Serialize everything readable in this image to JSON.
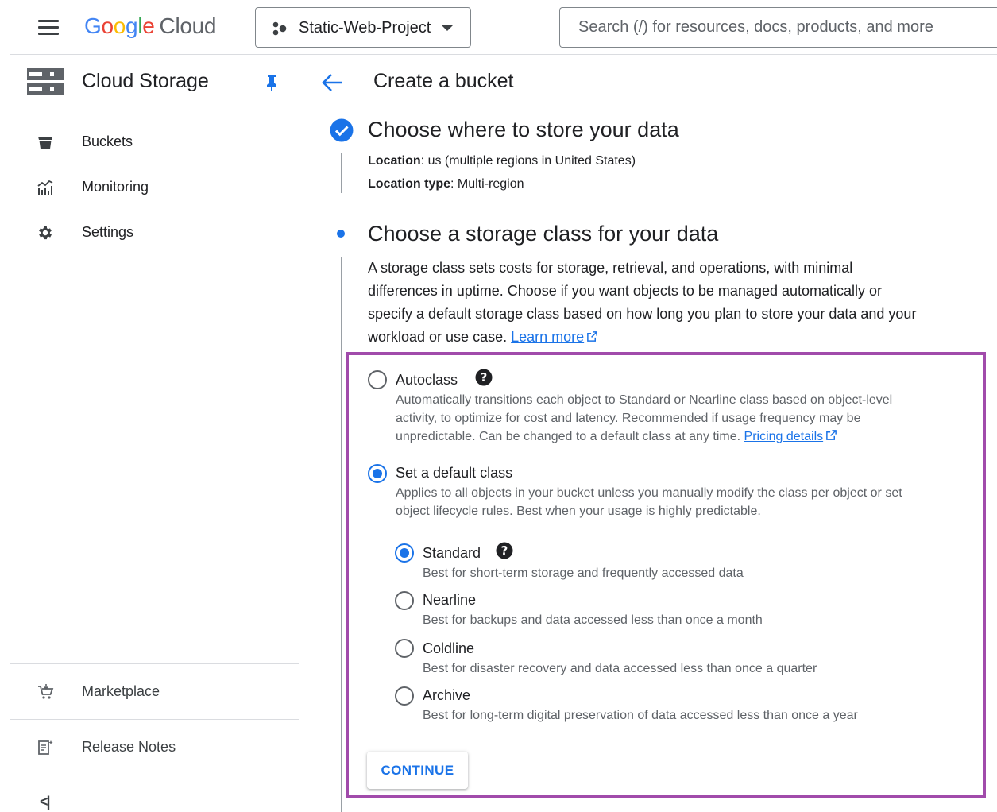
{
  "topbar": {
    "logo_google": [
      "G",
      "o",
      "o",
      "g",
      "l",
      "e"
    ],
    "logo_cloud": "Cloud",
    "project_name": "Static-Web-Project",
    "search_placeholder": "Search (/) for resources, docs, products, and more"
  },
  "sidebar": {
    "title": "Cloud Storage",
    "items": [
      {
        "label": "Buckets",
        "icon": "bucket-icon"
      },
      {
        "label": "Monitoring",
        "icon": "monitoring-icon"
      },
      {
        "label": "Settings",
        "icon": "gear-icon"
      }
    ],
    "bottom_items": [
      {
        "label": "Marketplace",
        "icon": "cart-icon"
      },
      {
        "label": "Release Notes",
        "icon": "notes-icon"
      }
    ],
    "collapse_label": "<|"
  },
  "header": {
    "title": "Create a bucket"
  },
  "step1": {
    "title": "Choose where to store your data",
    "location_key": "Location",
    "location_value": ": us (multiple regions in United States)",
    "location_type_key": "Location type",
    "location_type_value": ": Multi-region"
  },
  "step2": {
    "title": "Choose a storage class for your data",
    "description": "A storage class sets costs for storage, retrieval, and operations, with minimal differences in uptime. Choose if you want objects to be managed automatically or specify a default storage class based on how long you plan to store your data and your workload or use case.",
    "learn_more": "Learn more",
    "autoclass": {
      "label": "Autoclass",
      "description": "Automatically transitions each object to Standard or Nearline class based on object-level activity, to optimize for cost and latency. Recommended if usage frequency may be unpredictable. Can be changed to a default class at any time.",
      "pricing_link": "Pricing details",
      "selected": false
    },
    "default_class": {
      "label": "Set a default class",
      "description": "Applies to all objects in your bucket unless you manually modify the class per object or set object lifecycle rules. Best when your usage is highly predictable.",
      "selected": true
    },
    "classes": [
      {
        "label": "Standard",
        "description": "Best for short-term storage and frequently accessed data",
        "selected": true
      },
      {
        "label": "Nearline",
        "description": "Best for backups and data accessed less than once a month",
        "selected": false
      },
      {
        "label": "Coldline",
        "description": "Best for disaster recovery and data accessed less than once a quarter",
        "selected": false
      },
      {
        "label": "Archive",
        "description": "Best for long-term digital preservation of data accessed less than once a year",
        "selected": false
      }
    ],
    "continue_label": "CONTINUE"
  },
  "colors": {
    "accent": "#1a73e8",
    "highlight": "#a14bab",
    "text": "#202124",
    "secondary_text": "#5f6368"
  }
}
